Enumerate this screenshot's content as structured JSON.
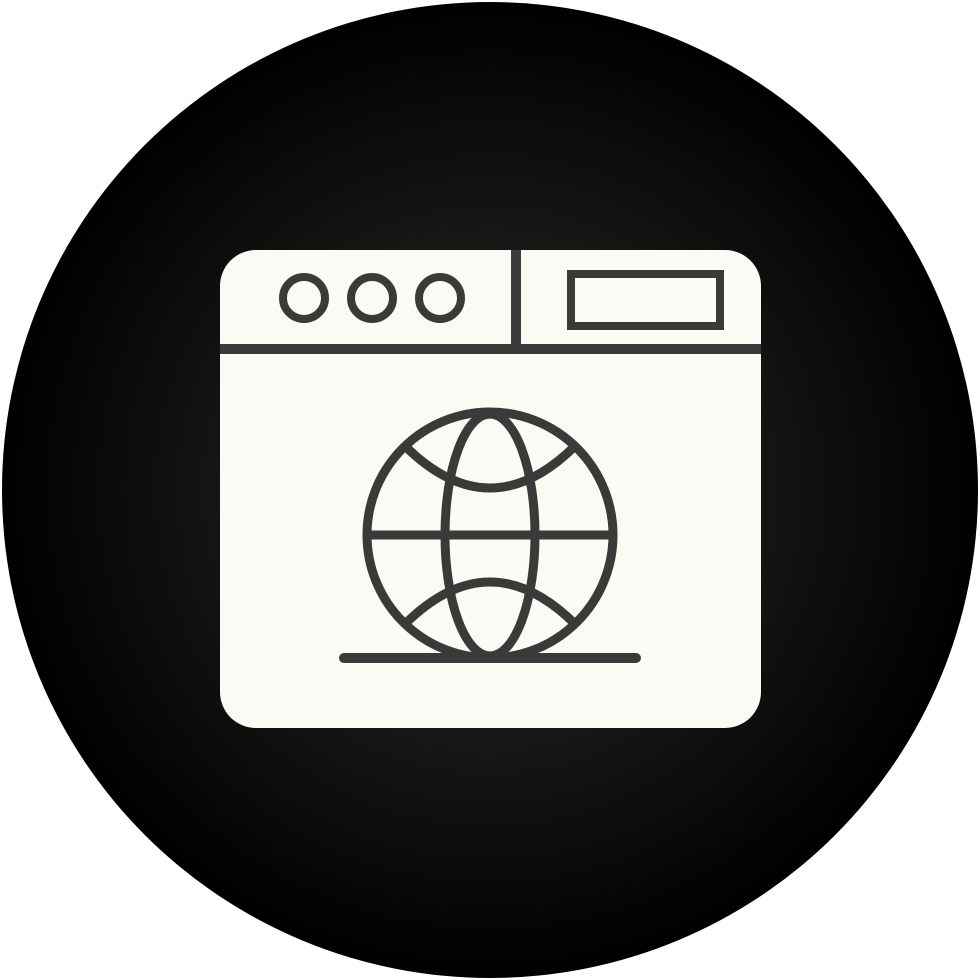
{
  "icon": {
    "name": "web-browser-globe-icon",
    "colors": {
      "background_outer": "#ffffff",
      "circle_center": "#2a2a2a",
      "circle_edge": "#000000",
      "glyph_fill": "#fbfbf5",
      "glyph_stroke": "#3a3a3a"
    }
  }
}
